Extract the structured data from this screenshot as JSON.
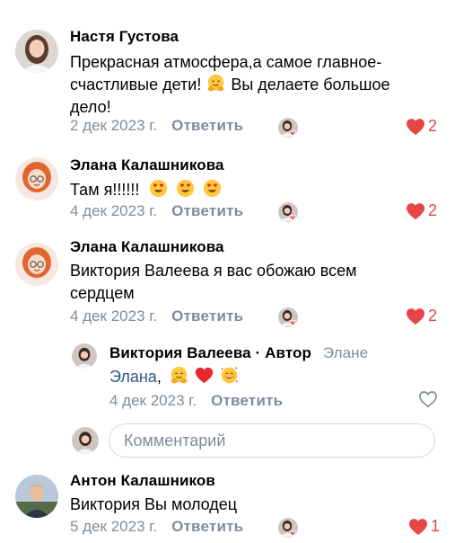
{
  "comments": [
    {
      "author": "Настя Густова",
      "text_lines": [
        "Прекрасная атмосфера,а самое главное-",
        "счастливые дети!",
        "Вы делаете большое",
        "дело!"
      ],
      "date": "2 дек 2023 г.",
      "reply_label": "Ответить",
      "likes": "2",
      "icons": [
        "smiling-face-hugging-emoji"
      ]
    },
    {
      "author": "Элана Калашникова",
      "text": "Там я!!!!!!",
      "date": "4 дек 2023 г.",
      "reply_label": "Ответить",
      "likes": "2",
      "icons": [
        "heart-eyes-emoji",
        "heart-eyes-emoji",
        "heart-eyes-emoji"
      ]
    },
    {
      "author": "Элана Калашникова",
      "text_lines": [
        "Виктория Валеева я вас обожаю всем",
        "сердцем"
      ],
      "date": "4 дек 2023 г.",
      "reply_label": "Ответить",
      "likes": "2"
    }
  ],
  "nested_reply": {
    "author": "Виктория Валеева",
    "author_suffix": "· Автор",
    "reply_to": "Элане",
    "mention": "Элана",
    "after_mention": ",",
    "date": "4 дек 2023 г.",
    "reply_label": "Ответить",
    "icons": [
      "smiling-face-hugging-emoji",
      "red-heart-emoji",
      "smiling-face-with-hearts-emoji"
    ]
  },
  "comment_input": {
    "placeholder": "Комментарий"
  },
  "last_comment": {
    "author": "Антон Калашников",
    "text": "Виктория Вы молодец",
    "date": "5 дек 2023 г.",
    "reply_label": "Ответить",
    "likes": "1"
  },
  "colors": {
    "like_red": "#e64646",
    "meta_gray": "#818c99",
    "mention_blue": "#2a5885"
  }
}
